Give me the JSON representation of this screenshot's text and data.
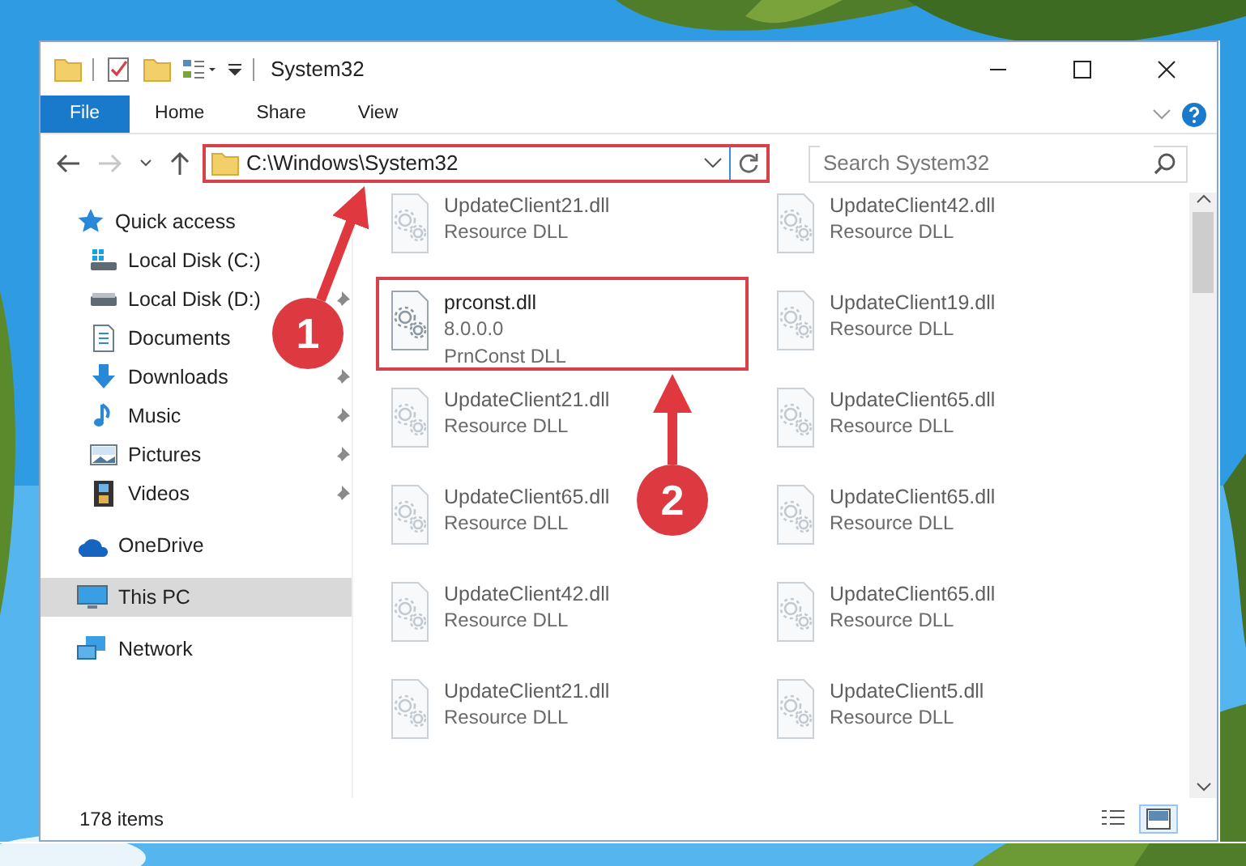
{
  "window": {
    "title": "System32"
  },
  "ribbon_tabs": [
    {
      "label": "File",
      "kind": "file"
    },
    {
      "label": "Home",
      "kind": "tab"
    },
    {
      "label": "Share",
      "kind": "tab"
    },
    {
      "label": "View",
      "kind": "tab"
    }
  ],
  "navigation": {
    "forward_disabled": true,
    "address": "C:\\Windows\\System32",
    "address_highlighted": true,
    "search": {
      "placeholder": "Search System32"
    }
  },
  "sidebar": {
    "items": [
      {
        "label": "Quick access",
        "selected": false,
        "children": [
          {
            "label": "Local Disk (C:)",
            "pinned": false,
            "selected": false
          },
          {
            "label": "Local Disk (D:)",
            "pinned": true,
            "selected": false
          },
          {
            "label": "Documents",
            "pinned": false,
            "selected": false
          },
          {
            "label": "Downloads",
            "pinned": true,
            "selected": false
          },
          {
            "label": "Music",
            "pinned": true,
            "selected": false
          },
          {
            "label": "Pictures",
            "pinned": true,
            "selected": false
          },
          {
            "label": "Videos",
            "pinned": true,
            "selected": false
          }
        ]
      },
      {
        "label": "OneDrive",
        "selected": false
      },
      {
        "label": "This PC",
        "selected": true
      },
      {
        "label": "Network",
        "selected": false
      }
    ]
  },
  "files": [
    {
      "name": "UpdateClient21.dll",
      "lines": [
        "Resource DLL"
      ],
      "dimmed": true,
      "highlighted": false
    },
    {
      "name": "UpdateClient42.dll",
      "lines": [
        "Resource DLL"
      ],
      "dimmed": true,
      "highlighted": false
    },
    {
      "name": "prconst.dll",
      "lines": [
        "8.0.0.0",
        "PrnConst DLL"
      ],
      "dimmed": false,
      "highlighted": true
    },
    {
      "name": "UpdateClient19.dll",
      "lines": [
        "Resource DLL"
      ],
      "dimmed": true,
      "highlighted": false
    },
    {
      "name": "UpdateClient21.dll",
      "lines": [
        "Resource DLL"
      ],
      "dimmed": true,
      "highlighted": false
    },
    {
      "name": "UpdateClient65.dll",
      "lines": [
        "Resource DLL"
      ],
      "dimmed": true,
      "highlighted": false
    },
    {
      "name": "UpdateClient65.dll",
      "lines": [
        "Resource DLL"
      ],
      "dimmed": true,
      "highlighted": false
    },
    {
      "name": "UpdateClient65.dll",
      "lines": [
        "Resource DLL"
      ],
      "dimmed": true,
      "highlighted": false
    },
    {
      "name": "UpdateClient42.dll",
      "lines": [
        "Resource DLL"
      ],
      "dimmed": true,
      "highlighted": false
    },
    {
      "name": "UpdateClient65.dll",
      "lines": [
        "Resource DLL"
      ],
      "dimmed": true,
      "highlighted": false
    },
    {
      "name": "UpdateClient21.dll",
      "lines": [
        "Resource DLL"
      ],
      "dimmed": true,
      "highlighted": false
    },
    {
      "name": "UpdateClient5.dll",
      "lines": [
        "Resource DLL"
      ],
      "dimmed": true,
      "highlighted": false
    }
  ],
  "status_bar": {
    "count": "178 items",
    "views": [
      {
        "kind": "details",
        "selected": false
      },
      {
        "kind": "large",
        "selected": true
      }
    ]
  },
  "annotations": [
    {
      "label": "1"
    },
    {
      "label": "2"
    }
  ]
}
